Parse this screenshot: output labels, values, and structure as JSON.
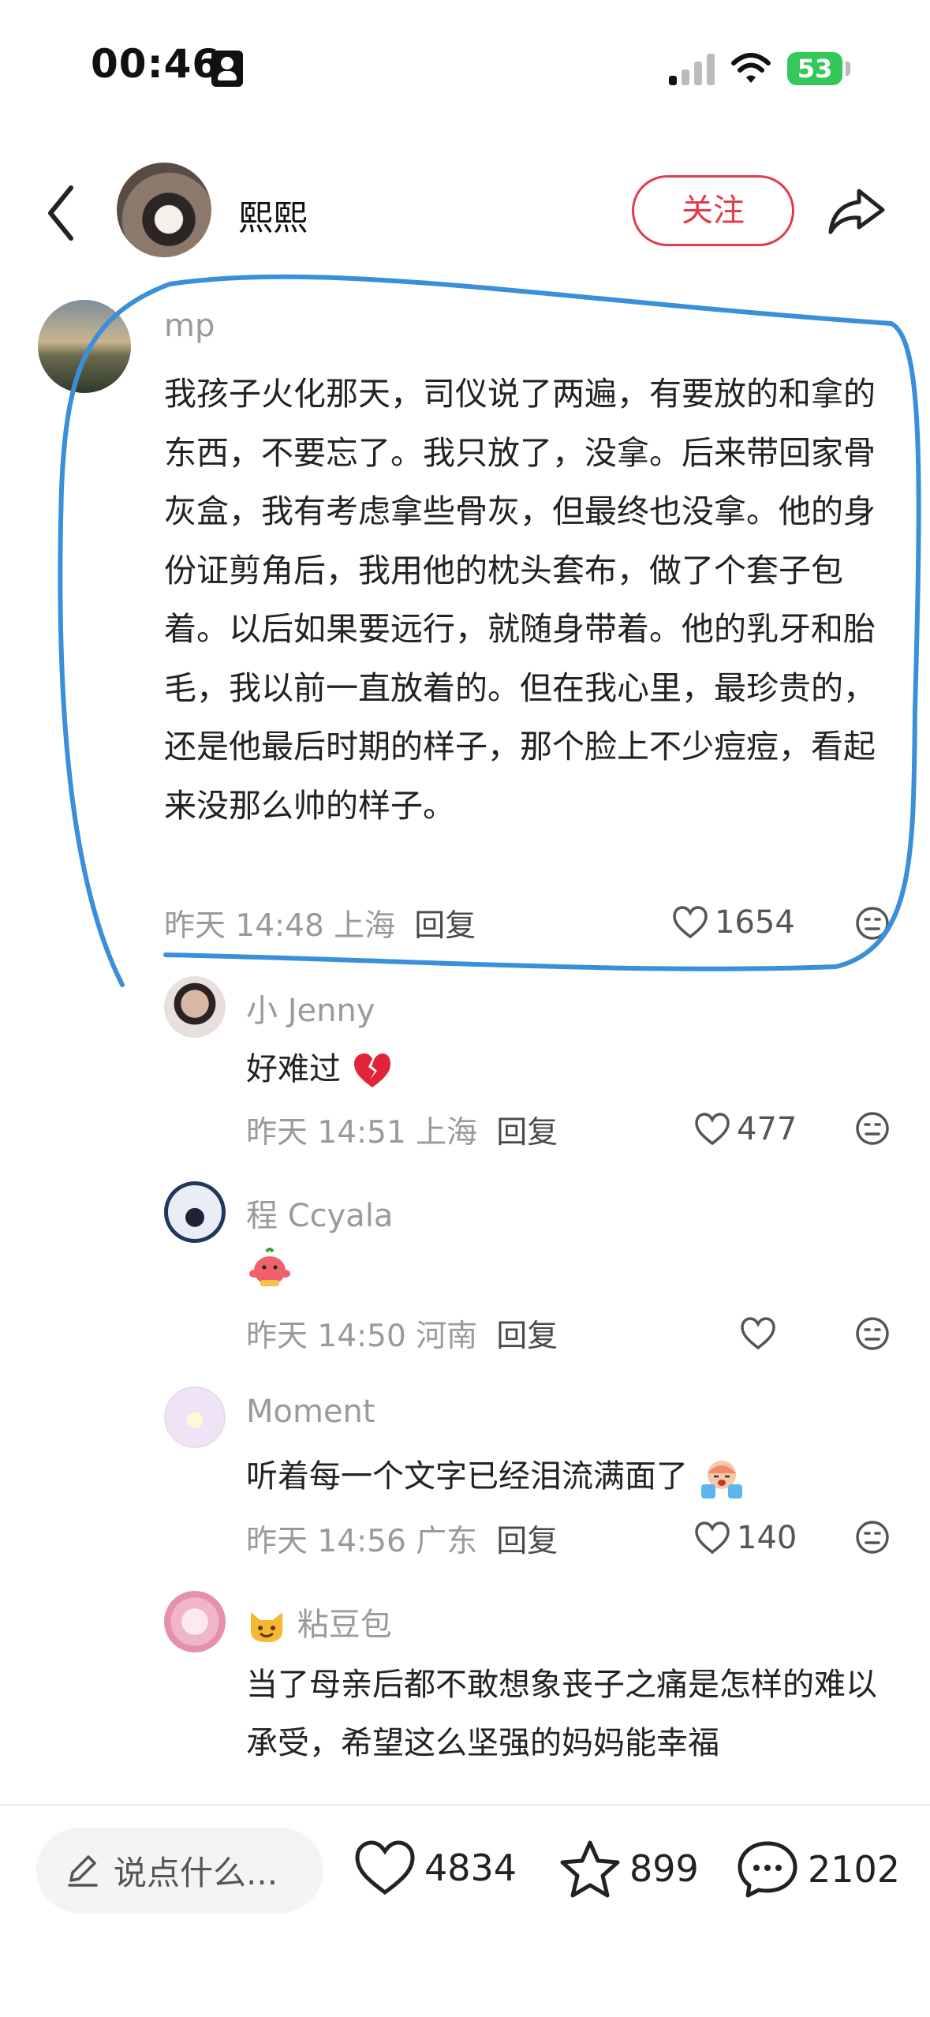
{
  "status_bar": {
    "time": "00:46",
    "battery": "53"
  },
  "header": {
    "author": "熙熙",
    "follow_label": "关注"
  },
  "main_comment": {
    "name": "mp",
    "text": "我孩子火化那天，司仪说了两遍，有要放的和拿的东西，不要忘了。我只放了，没拿。后来带回家骨灰盒，我有考虑拿些骨灰，但最终也没拿。他的身份证剪角后，我用他的枕头套布，做了个套子包着。以后如果要远行，就随身带着。他的乳牙和胎毛，我以前一直放着的。但在我心里，最珍贵的，还是他最后时期的样子，那个脸上不少痘痘，看起来没那么帅的样子。",
    "time": "昨天 14:48 上海",
    "reply": "回复",
    "likes": "1654"
  },
  "replies": [
    {
      "name": "小 Jenny",
      "text": "好难过",
      "time": "昨天 14:51 上海",
      "reply": "回复",
      "likes": "477"
    },
    {
      "name": "程 Ccyala",
      "text": "",
      "time": "昨天 14:50 河南",
      "reply": "回复",
      "likes": ""
    },
    {
      "name": "Moment",
      "text": "听着每一个文字已经泪流满面了",
      "time": "昨天 14:56 广东",
      "reply": "回复",
      "likes": "140"
    },
    {
      "name": "粘豆包",
      "text": "当了母亲后都不敢想象丧子之痛是怎样的难以承受，希望这么坚强的妈妈能幸福"
    }
  ],
  "bottom_bar": {
    "input_placeholder": "说点什么...",
    "likes": "4834",
    "stars": "899",
    "comments": "2102"
  },
  "colors": {
    "accent": "#e23b4a",
    "highlight": "#3b8fd9",
    "battery": "#34c759"
  }
}
